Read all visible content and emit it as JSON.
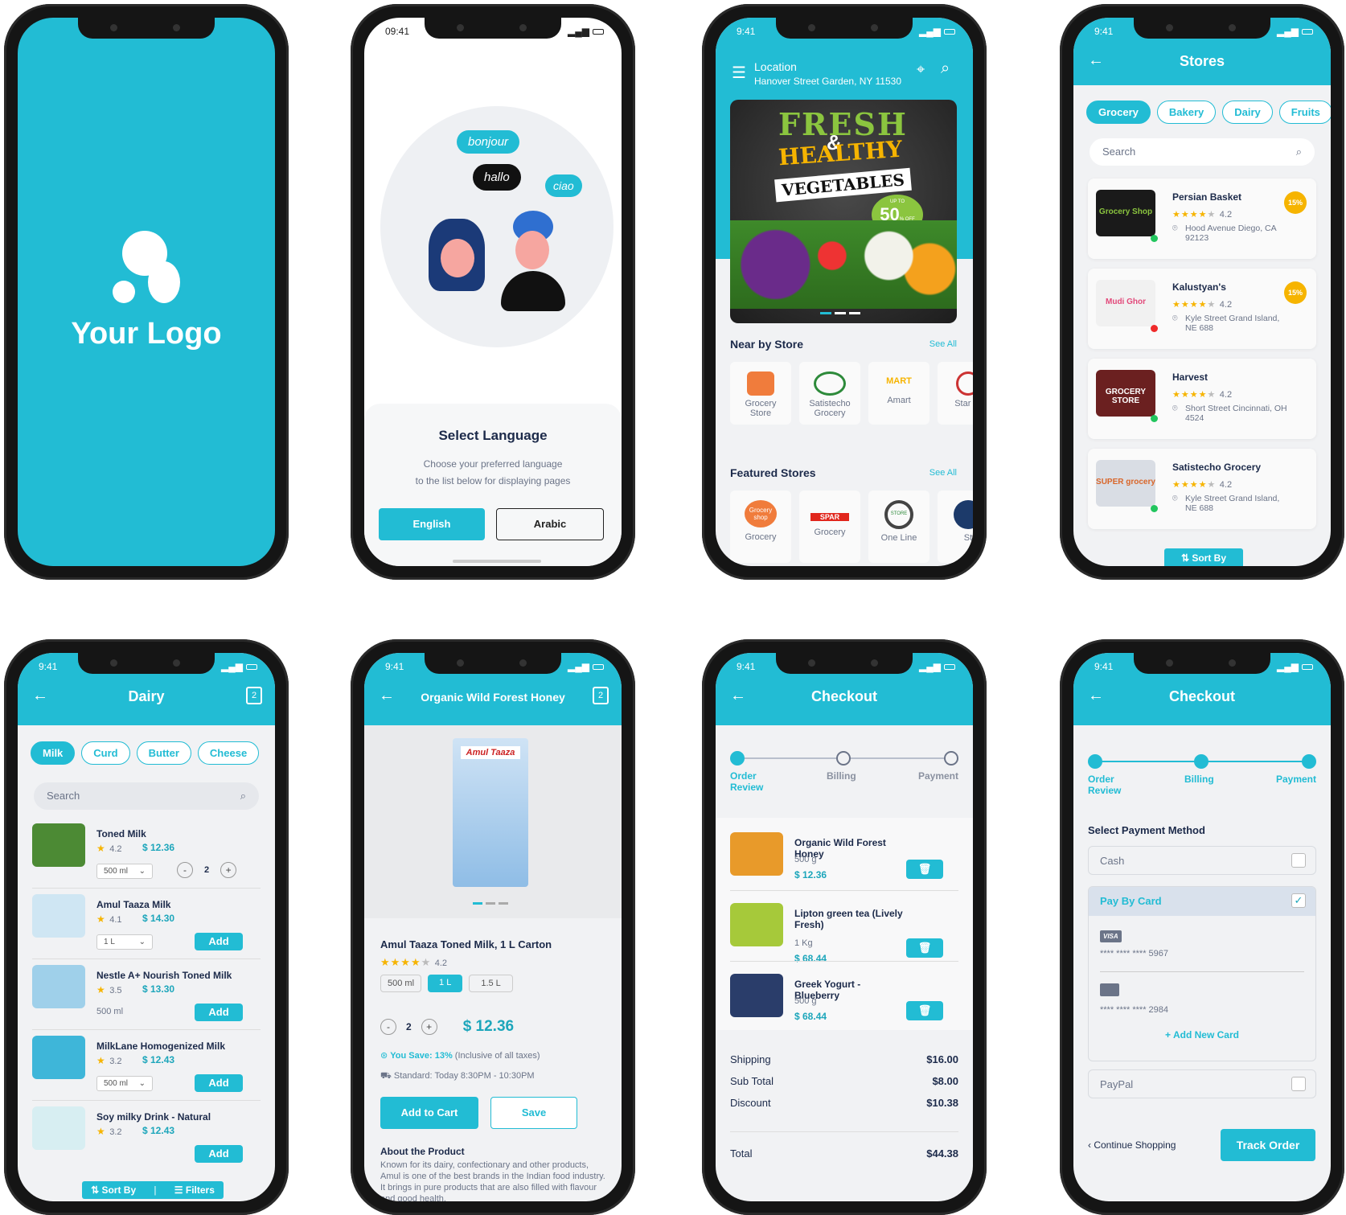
{
  "colors": {
    "accent": "#22bcd4",
    "star": "#f6b400",
    "online": "#22c55e",
    "offline": "#ef2a2a",
    "badge": "#f6b400"
  },
  "splash": {
    "logo": "Your Logo"
  },
  "language": {
    "time": "09:41",
    "bubbles": [
      "bonjour",
      "hallo",
      "ciao"
    ],
    "title": "Select Language",
    "desc1": "Choose your preferred language",
    "desc2": "to the list below for displaying pages",
    "english": "English",
    "arabic": "Arabic"
  },
  "home": {
    "time": "9:41",
    "location_label": "Location",
    "address": "Hanover Street Garden, NY 11530",
    "banner": {
      "l1": "FRESH",
      "amp": "&",
      "l2": "HEALTHY",
      "l3": "VEGETABLES",
      "upto": "UP TO",
      "pct": "50",
      "off": "% OFF"
    },
    "nearby_title": "Near by Store",
    "see_all": "See All",
    "nearby": [
      {
        "name": "Grocery Store"
      },
      {
        "name": "Satistecho Grocery"
      },
      {
        "name": "Amart",
        "logo": "MART"
      },
      {
        "name": "Star St"
      }
    ],
    "featured_title": "Featured Stores",
    "featured": [
      {
        "name": "Grocery",
        "logo": "Grocery shop"
      },
      {
        "name": "Grocery",
        "logo": "SPAR"
      },
      {
        "name": "One Line",
        "logo": "STORE"
      },
      {
        "name": "St"
      }
    ]
  },
  "stores": {
    "time": "9:41",
    "title": "Stores",
    "chips": [
      "Grocery",
      "Bakery",
      "Dairy",
      "Fruits"
    ],
    "search": "Search",
    "sort": "Sort By",
    "items": [
      {
        "name": "Persian Basket",
        "rating": "4.2",
        "addr1": "Hood Avenue Diego, CA",
        "addr2": "92123",
        "badge": "15%",
        "logo": "Grocery Shop",
        "status": "online"
      },
      {
        "name": "Kalustyan's",
        "rating": "4.2",
        "addr1": "Kyle Street Grand Island,",
        "addr2": "NE 688",
        "badge": "15%",
        "logo": "Mudi Ghor",
        "status": "offline"
      },
      {
        "name": "Harvest",
        "rating": "4.2",
        "addr1": "Short Street Cincinnati, OH",
        "addr2": "4524",
        "logo": "GROCERY STORE",
        "status": "online"
      },
      {
        "name": "Satistecho Grocery",
        "rating": "4.2",
        "addr1": "Kyle Street Grand Island,",
        "addr2": "NE 688",
        "logo": "SUPER grocery",
        "status": "online"
      }
    ]
  },
  "dairy": {
    "time": "9:41",
    "title": "Dairy",
    "cart_count": "2",
    "chips": [
      "Milk",
      "Curd",
      "Butter",
      "Cheese"
    ],
    "search": "Search",
    "sort": "Sort By",
    "filters": "Filters",
    "add": "Add",
    "items": [
      {
        "name": "Toned Milk",
        "rating": "4.2",
        "price": "$ 12.36",
        "size": "500 ml",
        "qty": "2"
      },
      {
        "name": "Amul Taaza Milk",
        "rating": "4.1",
        "price": "$ 14.30",
        "size": "1 L"
      },
      {
        "name": "Nestle A+ Nourish Toned Milk",
        "rating": "3.5",
        "price": "$ 13.30",
        "size": "500 ml"
      },
      {
        "name": "MilkLane Homogenized Milk",
        "rating": "3.2",
        "price": "$ 12.43",
        "size": "500 ml"
      },
      {
        "name": "Soy milky Drink - Natural",
        "rating": "3.2",
        "price": "$ 12.43"
      }
    ]
  },
  "product": {
    "time": "9:41",
    "title": "Organic Wild Forest Honey",
    "cart_count": "2",
    "pack": "Amul Taaza",
    "name": "Amul Taaza Toned Milk, 1 L Carton",
    "rating": "4.2",
    "sizes": [
      "500 ml",
      "1 L",
      "1.5 L"
    ],
    "qty": "2",
    "price": "$ 12.36",
    "save_label": "You Save: 13%",
    "save_note": "(Inclusive of all taxes)",
    "delivery": "Standard: Today 8:30PM - 10:30PM",
    "add_cart": "Add to Cart",
    "save": "Save",
    "about_title": "About the Product",
    "about": "Known for its dairy, confectionary and other products, Amul is one of the best brands in the Indian food industry. It brings in pure products that are also filled with flavour and good health."
  },
  "checkout": {
    "time": "9:41",
    "title": "Checkout",
    "steps": [
      "Order Review",
      "Billing",
      "Payment"
    ],
    "items": [
      {
        "name": "Organic Wild Forest Honey",
        "qty": "500 g",
        "price": "$ 12.36"
      },
      {
        "name": "Lipton green tea (Lively Fresh)",
        "qty": "1 Kg",
        "price": "$ 68.44"
      },
      {
        "name": "Greek Yogurt - Blueberry",
        "qty": "500 g",
        "price": "$ 68.44"
      }
    ],
    "summary": [
      {
        "label": "Shipping",
        "value": "$16.00"
      },
      {
        "label": "Sub Total",
        "value": "$8.00"
      },
      {
        "label": "Discount",
        "value": "$10.38"
      }
    ],
    "total_label": "Total",
    "total": "$44.38"
  },
  "payment": {
    "time": "9:41",
    "title": "Checkout",
    "steps": [
      "Order Review",
      "Billing",
      "Payment"
    ],
    "heading": "Select Payment Method",
    "cash": "Cash",
    "card": "Pay By Card",
    "card_selected": true,
    "visa": "VISA",
    "card1": "**** **** **** 5967",
    "card2": "**** **** **** 2984",
    "add_card": "+ Add New Card",
    "paypal": "PayPal",
    "continue": "Continue Shopping",
    "track": "Track Order"
  }
}
